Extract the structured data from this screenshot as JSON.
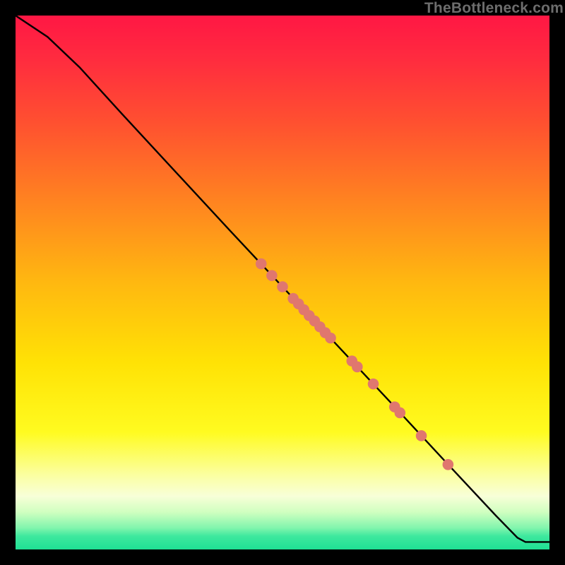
{
  "watermark": "TheBottleneck.com",
  "chart_data": {
    "type": "line",
    "title": "",
    "xlabel": "",
    "ylabel": "",
    "xlim": [
      0,
      100
    ],
    "ylim": [
      0,
      100
    ],
    "curve": [
      {
        "x": 0,
        "y": 100
      },
      {
        "x": 6,
        "y": 96.0
      },
      {
        "x": 12,
        "y": 90.3
      },
      {
        "x": 20,
        "y": 81.5
      },
      {
        "x": 30,
        "y": 70.7
      },
      {
        "x": 40,
        "y": 59.9
      },
      {
        "x": 50,
        "y": 49.2
      },
      {
        "x": 60,
        "y": 38.5
      },
      {
        "x": 70,
        "y": 27.8
      },
      {
        "x": 80,
        "y": 17.0
      },
      {
        "x": 90,
        "y": 6.3
      },
      {
        "x": 94,
        "y": 2.2
      },
      {
        "x": 95.5,
        "y": 1.4
      },
      {
        "x": 100,
        "y": 1.4
      }
    ],
    "markers": [
      {
        "x": 46,
        "y": 53.5
      },
      {
        "x": 48,
        "y": 51.3
      },
      {
        "x": 50,
        "y": 49.2
      },
      {
        "x": 52,
        "y": 47.0
      },
      {
        "x": 53,
        "y": 46.0
      },
      {
        "x": 54,
        "y": 44.9
      },
      {
        "x": 55,
        "y": 43.8
      },
      {
        "x": 56,
        "y": 42.8
      },
      {
        "x": 57,
        "y": 41.7
      },
      {
        "x": 58,
        "y": 40.6
      },
      {
        "x": 59,
        "y": 39.6
      },
      {
        "x": 63,
        "y": 35.3
      },
      {
        "x": 64,
        "y": 34.2
      },
      {
        "x": 67,
        "y": 31.0
      },
      {
        "x": 71,
        "y": 26.7
      },
      {
        "x": 72,
        "y": 25.6
      },
      {
        "x": 76,
        "y": 21.3
      },
      {
        "x": 81,
        "y": 15.9
      }
    ],
    "marker_color": "#e0776e",
    "line_color": "#000000",
    "gradient_stops": [
      {
        "pos": 0.0,
        "color": "#ff1744"
      },
      {
        "pos": 0.08,
        "color": "#ff2b3f"
      },
      {
        "pos": 0.2,
        "color": "#ff5030"
      },
      {
        "pos": 0.35,
        "color": "#ff8420"
      },
      {
        "pos": 0.5,
        "color": "#ffb810"
      },
      {
        "pos": 0.65,
        "color": "#ffe205"
      },
      {
        "pos": 0.78,
        "color": "#fffb20"
      },
      {
        "pos": 0.86,
        "color": "#fbffa0"
      },
      {
        "pos": 0.9,
        "color": "#f8ffd8"
      },
      {
        "pos": 0.93,
        "color": "#d0ffc0"
      },
      {
        "pos": 0.96,
        "color": "#80f5ad"
      },
      {
        "pos": 0.975,
        "color": "#3ee89e"
      },
      {
        "pos": 1.0,
        "color": "#1fe094"
      }
    ]
  }
}
